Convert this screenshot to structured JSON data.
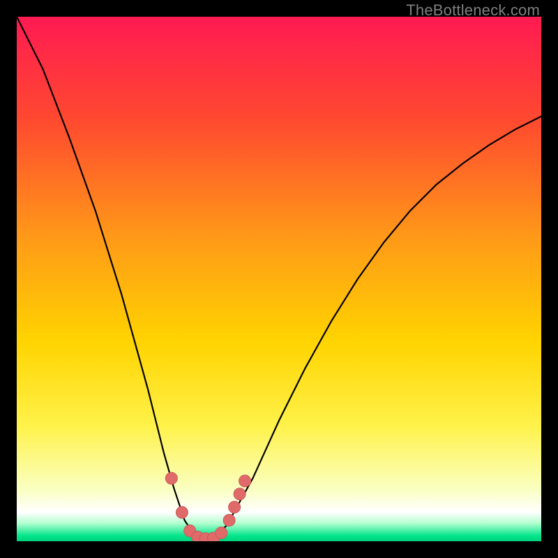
{
  "watermark": "TheBottleneck.com",
  "colors": {
    "frame": "#000000",
    "gradient_stops": [
      {
        "offset": 0.0,
        "color": "#ff1a52"
      },
      {
        "offset": 0.2,
        "color": "#ff4a2f"
      },
      {
        "offset": 0.42,
        "color": "#ff9918"
      },
      {
        "offset": 0.62,
        "color": "#ffd400"
      },
      {
        "offset": 0.78,
        "color": "#fff24a"
      },
      {
        "offset": 0.9,
        "color": "#faffc0"
      },
      {
        "offset": 0.945,
        "color": "#ffffff"
      },
      {
        "offset": 0.965,
        "color": "#b6ffd0"
      },
      {
        "offset": 0.99,
        "color": "#00e58a"
      },
      {
        "offset": 1.0,
        "color": "#00d17e"
      }
    ],
    "curve": "#000000",
    "marker_fill": "#e06a6a",
    "marker_stroke": "#cc5858"
  },
  "chart_data": {
    "type": "line",
    "title": "",
    "xlabel": "",
    "ylabel": "",
    "xlim": [
      0,
      100
    ],
    "ylim": [
      0,
      100
    ],
    "series": [
      {
        "name": "bottleneck-curve",
        "x": [
          0,
          5,
          10,
          15,
          20,
          25,
          28,
          30,
          32,
          34,
          36,
          38,
          40,
          45,
          50,
          55,
          60,
          65,
          70,
          75,
          80,
          85,
          90,
          95,
          100
        ],
        "y": [
          100,
          90,
          77,
          63,
          47,
          29,
          17,
          10,
          4,
          1,
          0,
          1,
          3,
          12,
          23,
          33,
          42,
          50,
          57,
          63,
          68,
          72,
          75.5,
          78.5,
          81
        ]
      }
    ],
    "markers": {
      "name": "highlighted-points",
      "x": [
        29.5,
        31.5,
        33.0,
        34.5,
        36.0,
        37.5,
        39.0,
        40.5,
        41.5,
        42.5,
        43.5
      ],
      "y": [
        12.0,
        5.5,
        2.0,
        0.8,
        0.5,
        0.6,
        1.6,
        4.0,
        6.5,
        9.0,
        11.5
      ]
    }
  }
}
